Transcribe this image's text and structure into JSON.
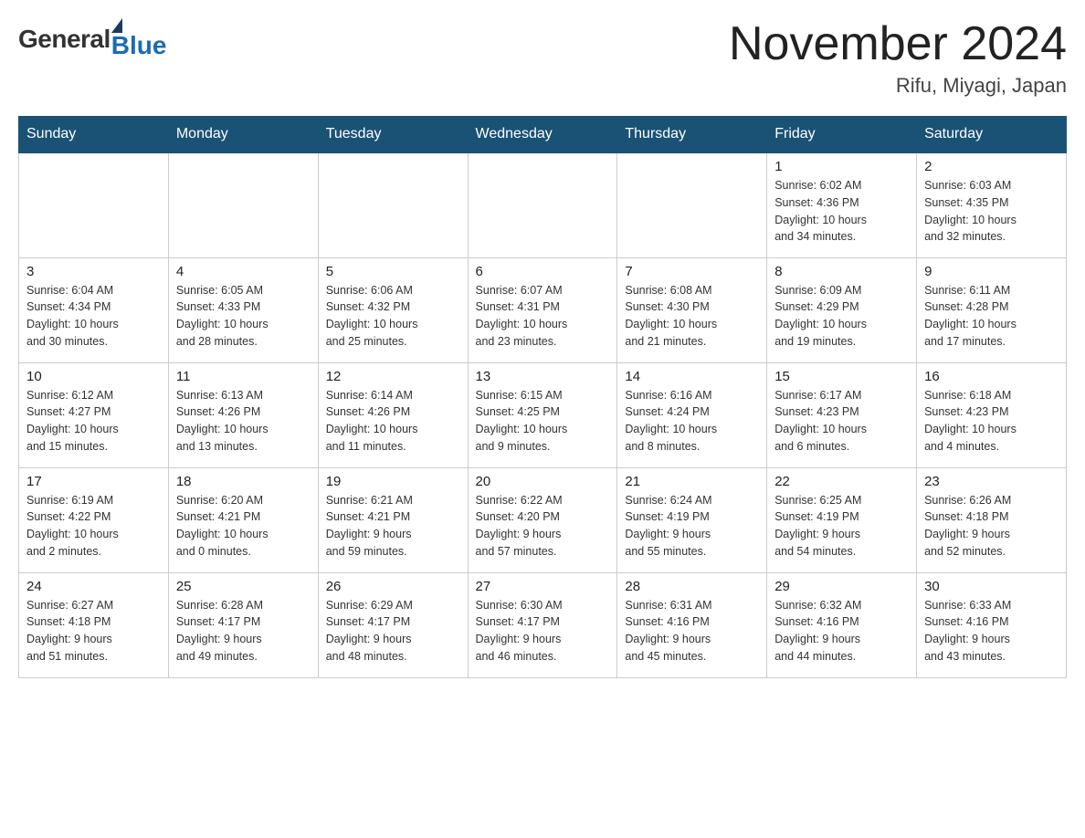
{
  "header": {
    "logo_general": "General",
    "logo_blue": "Blue",
    "month_title": "November 2024",
    "location": "Rifu, Miyagi, Japan"
  },
  "calendar": {
    "days_of_week": [
      "Sunday",
      "Monday",
      "Tuesday",
      "Wednesday",
      "Thursday",
      "Friday",
      "Saturday"
    ],
    "weeks": [
      [
        {
          "day": "",
          "info": ""
        },
        {
          "day": "",
          "info": ""
        },
        {
          "day": "",
          "info": ""
        },
        {
          "day": "",
          "info": ""
        },
        {
          "day": "",
          "info": ""
        },
        {
          "day": "1",
          "info": "Sunrise: 6:02 AM\nSunset: 4:36 PM\nDaylight: 10 hours\nand 34 minutes."
        },
        {
          "day": "2",
          "info": "Sunrise: 6:03 AM\nSunset: 4:35 PM\nDaylight: 10 hours\nand 32 minutes."
        }
      ],
      [
        {
          "day": "3",
          "info": "Sunrise: 6:04 AM\nSunset: 4:34 PM\nDaylight: 10 hours\nand 30 minutes."
        },
        {
          "day": "4",
          "info": "Sunrise: 6:05 AM\nSunset: 4:33 PM\nDaylight: 10 hours\nand 28 minutes."
        },
        {
          "day": "5",
          "info": "Sunrise: 6:06 AM\nSunset: 4:32 PM\nDaylight: 10 hours\nand 25 minutes."
        },
        {
          "day": "6",
          "info": "Sunrise: 6:07 AM\nSunset: 4:31 PM\nDaylight: 10 hours\nand 23 minutes."
        },
        {
          "day": "7",
          "info": "Sunrise: 6:08 AM\nSunset: 4:30 PM\nDaylight: 10 hours\nand 21 minutes."
        },
        {
          "day": "8",
          "info": "Sunrise: 6:09 AM\nSunset: 4:29 PM\nDaylight: 10 hours\nand 19 minutes."
        },
        {
          "day": "9",
          "info": "Sunrise: 6:11 AM\nSunset: 4:28 PM\nDaylight: 10 hours\nand 17 minutes."
        }
      ],
      [
        {
          "day": "10",
          "info": "Sunrise: 6:12 AM\nSunset: 4:27 PM\nDaylight: 10 hours\nand 15 minutes."
        },
        {
          "day": "11",
          "info": "Sunrise: 6:13 AM\nSunset: 4:26 PM\nDaylight: 10 hours\nand 13 minutes."
        },
        {
          "day": "12",
          "info": "Sunrise: 6:14 AM\nSunset: 4:26 PM\nDaylight: 10 hours\nand 11 minutes."
        },
        {
          "day": "13",
          "info": "Sunrise: 6:15 AM\nSunset: 4:25 PM\nDaylight: 10 hours\nand 9 minutes."
        },
        {
          "day": "14",
          "info": "Sunrise: 6:16 AM\nSunset: 4:24 PM\nDaylight: 10 hours\nand 8 minutes."
        },
        {
          "day": "15",
          "info": "Sunrise: 6:17 AM\nSunset: 4:23 PM\nDaylight: 10 hours\nand 6 minutes."
        },
        {
          "day": "16",
          "info": "Sunrise: 6:18 AM\nSunset: 4:23 PM\nDaylight: 10 hours\nand 4 minutes."
        }
      ],
      [
        {
          "day": "17",
          "info": "Sunrise: 6:19 AM\nSunset: 4:22 PM\nDaylight: 10 hours\nand 2 minutes."
        },
        {
          "day": "18",
          "info": "Sunrise: 6:20 AM\nSunset: 4:21 PM\nDaylight: 10 hours\nand 0 minutes."
        },
        {
          "day": "19",
          "info": "Sunrise: 6:21 AM\nSunset: 4:21 PM\nDaylight: 9 hours\nand 59 minutes."
        },
        {
          "day": "20",
          "info": "Sunrise: 6:22 AM\nSunset: 4:20 PM\nDaylight: 9 hours\nand 57 minutes."
        },
        {
          "day": "21",
          "info": "Sunrise: 6:24 AM\nSunset: 4:19 PM\nDaylight: 9 hours\nand 55 minutes."
        },
        {
          "day": "22",
          "info": "Sunrise: 6:25 AM\nSunset: 4:19 PM\nDaylight: 9 hours\nand 54 minutes."
        },
        {
          "day": "23",
          "info": "Sunrise: 6:26 AM\nSunset: 4:18 PM\nDaylight: 9 hours\nand 52 minutes."
        }
      ],
      [
        {
          "day": "24",
          "info": "Sunrise: 6:27 AM\nSunset: 4:18 PM\nDaylight: 9 hours\nand 51 minutes."
        },
        {
          "day": "25",
          "info": "Sunrise: 6:28 AM\nSunset: 4:17 PM\nDaylight: 9 hours\nand 49 minutes."
        },
        {
          "day": "26",
          "info": "Sunrise: 6:29 AM\nSunset: 4:17 PM\nDaylight: 9 hours\nand 48 minutes."
        },
        {
          "day": "27",
          "info": "Sunrise: 6:30 AM\nSunset: 4:17 PM\nDaylight: 9 hours\nand 46 minutes."
        },
        {
          "day": "28",
          "info": "Sunrise: 6:31 AM\nSunset: 4:16 PM\nDaylight: 9 hours\nand 45 minutes."
        },
        {
          "day": "29",
          "info": "Sunrise: 6:32 AM\nSunset: 4:16 PM\nDaylight: 9 hours\nand 44 minutes."
        },
        {
          "day": "30",
          "info": "Sunrise: 6:33 AM\nSunset: 4:16 PM\nDaylight: 9 hours\nand 43 minutes."
        }
      ]
    ]
  }
}
